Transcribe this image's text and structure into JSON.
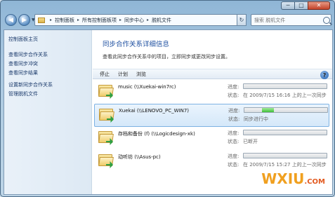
{
  "window": {
    "controls": {
      "minimize": "─",
      "maximize": "□",
      "close": "✕"
    }
  },
  "address": {
    "crumbs": [
      "控制面板",
      "所有控制面板项",
      "同步中心",
      "脱机文件"
    ]
  },
  "search": {
    "placeholder": "搜索 脱机文件"
  },
  "sidebar": {
    "items": [
      {
        "label": "控制面板主页"
      },
      {
        "label": "查看同步合作关系"
      },
      {
        "label": "查看同步冲突"
      },
      {
        "label": "查看同步结果"
      },
      {
        "label": "设置新同步合作关系"
      },
      {
        "label": "管理脱机文件"
      }
    ]
  },
  "main": {
    "title": "同步合作关系详细信息",
    "description": "查看此同步合作关系中的项目，立即同步或更改同步设置。",
    "commands": {
      "stop": "停止",
      "schedule": "计划",
      "browse": "浏览"
    },
    "help": "?"
  },
  "progress_label": "进度:",
  "status_label": "状态:",
  "items": [
    {
      "name": "music (\\\\Xuekai-win7rc)",
      "progress": 0.0,
      "status": "在 2009/7/15 16:16 上的上一次同步"
    },
    {
      "name": "Xuekai (\\\\LENOVO_PC_WIN7)",
      "progress": 0.14,
      "status": "同步进行中"
    },
    {
      "name": "存档和备份 (f) (\\\\Logicdesign-xk)",
      "progress": 0.0,
      "status": "已断开"
    },
    {
      "name": "动听坊 (\\\\Asus-pc)",
      "progress": 0.0,
      "status": "在 2009/7/15 15:27 上的上一次同步"
    }
  ],
  "watermark": {
    "main": "WXIU",
    "suffix": ".COM"
  }
}
